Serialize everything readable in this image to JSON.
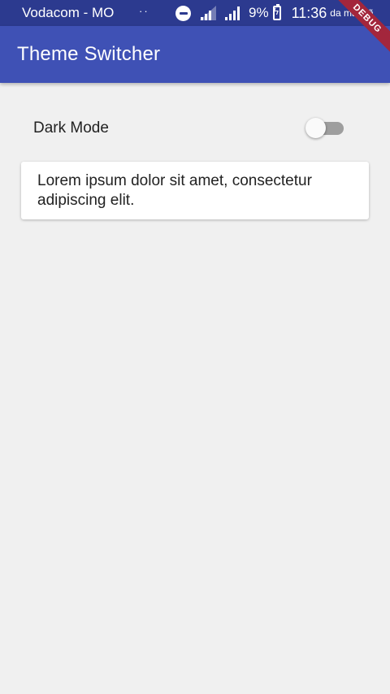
{
  "status_bar": {
    "carrier": "Vodacom - MO",
    "dots": "··",
    "battery_percent": "9%",
    "time": "11:36",
    "time_suffix": "da manhã",
    "icons": [
      "do-not-disturb-icon",
      "signal-icon",
      "signal-icon",
      "battery-charging-icon"
    ]
  },
  "app_bar": {
    "title": "Theme Switcher"
  },
  "debug_banner": {
    "label": "DEBUG"
  },
  "settings": {
    "dark_mode_label": "Dark Mode",
    "dark_mode_on": false
  },
  "card": {
    "text": "Lorem ipsum dolor sit amet, consectetur adipiscing elit."
  },
  "colors": {
    "app_bar": "#3f51b5",
    "status_bar": "#2c3a8f",
    "background": "#f0f0f0",
    "debug_banner": "#a3263c"
  }
}
